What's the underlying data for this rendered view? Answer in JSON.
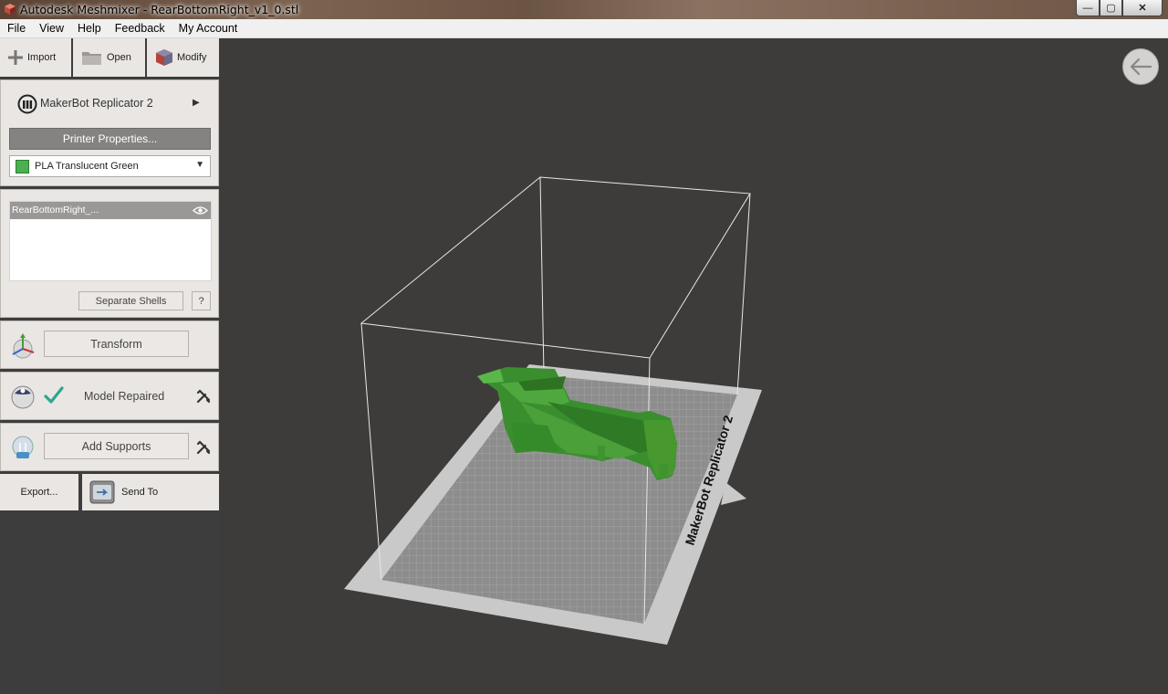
{
  "window": {
    "title": "Autodesk Meshmixer - RearBottomRight_v1_0.stl",
    "buttons": {
      "minimize": "—",
      "maximize": "▢",
      "close": "✕"
    }
  },
  "menu": [
    "File",
    "View",
    "Help",
    "Feedback",
    "My Account"
  ],
  "toolbar": {
    "import": "Import",
    "open": "Open",
    "modify": "Modify"
  },
  "printer": {
    "name": "MakerBot Replicator 2",
    "properties_label": "Printer Properties...",
    "material": "PLA Translucent Green",
    "material_color": "#4caf50"
  },
  "objects": {
    "items": [
      "RearBottomRight_..."
    ],
    "separate_shells_label": "Separate Shells",
    "help_label": "?"
  },
  "steps": {
    "transform": "Transform",
    "repair_status": "Model Repaired",
    "add_supports": "Add Supports"
  },
  "output": {
    "export": "Export...",
    "send_to": "Send To"
  },
  "scene": {
    "bed_label": "MakerBot Replicator 2",
    "model_color": "#3a8e2e"
  }
}
